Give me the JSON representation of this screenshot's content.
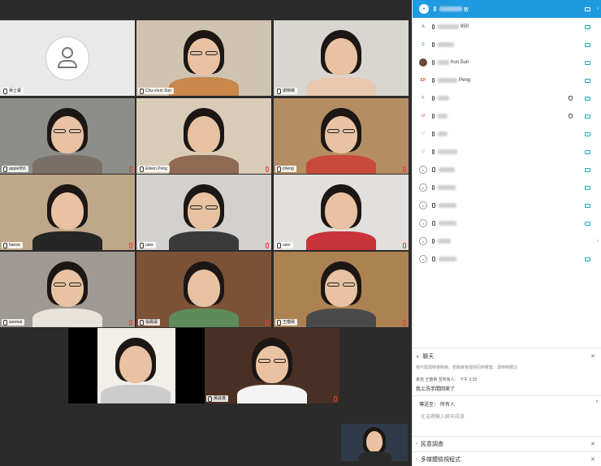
{
  "participants_panel": {
    "rows": [
      {
        "avatar": "icon",
        "avatar_color": "#1e9ae0",
        "name": "敷",
        "device": "mic",
        "camera": "on",
        "selected": true,
        "hand": false,
        "chevron": true
      },
      {
        "avatar": "A",
        "avatar_color": "#5aa6d8",
        "name": "950",
        "device": "mic",
        "camera": "on",
        "hand": false
      },
      {
        "avatar": "C",
        "avatar_color": "#3bb07a",
        "name": "",
        "device": "mic",
        "camera": "on",
        "hand": false
      },
      {
        "avatar": "photo",
        "avatar_color": "#6b4a3a",
        "name": "hun Sun",
        "device": "mic",
        "camera": "on",
        "hand": false
      },
      {
        "avatar": "EP",
        "avatar_color": "#e8594a",
        "name": "Peng",
        "device": "mic",
        "camera": "on",
        "hand": false
      },
      {
        "avatar": "F",
        "avatar_color": "#5aa6d8",
        "name": "",
        "device": "mic",
        "camera": "on",
        "hand": true
      },
      {
        "avatar": "U",
        "avatar_color": "#e8594a",
        "name": "",
        "device": "mic",
        "camera": "on",
        "hand": true
      },
      {
        "avatar": "U",
        "avatar_color": "#c7c7c7",
        "name": "",
        "device": "mic",
        "camera": "on",
        "hand": false
      },
      {
        "avatar": "U",
        "avatar_color": "#c7c7c7",
        "name": "",
        "device": "mic",
        "camera": "on",
        "hand": false
      },
      {
        "avatar": "person",
        "avatar_color": "#c7c7c7",
        "name": "",
        "device": "phone",
        "camera": "on",
        "hand": false
      },
      {
        "avatar": "person",
        "avatar_color": "#c7c7c7",
        "name": "",
        "device": "mic",
        "camera": "on",
        "hand": false
      },
      {
        "avatar": "person",
        "avatar_color": "#c7c7c7",
        "name": "",
        "device": "phone",
        "camera": "on",
        "hand": false
      },
      {
        "avatar": "person",
        "avatar_color": "#c7c7c7",
        "name": "",
        "device": "phone",
        "camera": "on",
        "hand": false
      },
      {
        "avatar": "person",
        "avatar_color": "#c7c7c7",
        "name": "",
        "device": "mic",
        "camera": "none",
        "hand": false
      },
      {
        "avatar": "person",
        "avatar_color": "#c7c7c7",
        "name": "",
        "device": "phone",
        "camera": "on",
        "hand": false
      }
    ]
  },
  "chat": {
    "header": "聊天",
    "line1": "我可能隨時會斷線，若斷線會儘快回到教室，請時時關注",
    "from_line": "來自 王瓊眞 至所有人：  下午 3:32",
    "message": "我上洗手間回來了",
    "to_label": "傳送至：",
    "to_value": "所有人",
    "input_placeholder": "在這裡輸入聊天訊息"
  },
  "sections": {
    "poll": "民意調查",
    "multimedia": "多媒體檢視程式"
  },
  "video_tiles": [
    {
      "name": "黃士寶",
      "kind": "avatar",
      "bg": "#e9e9e9",
      "red_mic": false
    },
    {
      "name": "Chu-chun Sun",
      "kind": "person",
      "bg": "#cfc3b2",
      "shirt": "#c9874a",
      "red_mic": false
    },
    {
      "name": "謝曉薇",
      "kind": "person",
      "bg": "#d9d6d2",
      "shirt": "#e9c8b0",
      "red_mic": false
    },
    {
      "name": "apple950",
      "kind": "person",
      "bg": "#8d8d8a",
      "shirt": "#7a6f66",
      "red_mic": true
    },
    {
      "name": "Eileen Peng",
      "kind": "person",
      "bg": "#d8ccb8",
      "shirt": "#8f6b52",
      "red_mic": true
    },
    {
      "name": "cheng",
      "kind": "person",
      "bg": "#b58d63",
      "shirt": "#c84a3a",
      "red_mic": true
    },
    {
      "name": "hanse",
      "kind": "person",
      "bg": "#bfa88a",
      "shirt": "#262626",
      "red_mic": true
    },
    {
      "name": "user",
      "kind": "person",
      "bg": "#d3d1cd",
      "shirt": "#3a3a3a",
      "red_mic": true
    },
    {
      "name": "user",
      "kind": "person",
      "bg": "#e2e0dd",
      "shirt": "#c8343a",
      "red_mic": true
    },
    {
      "name": "seemai",
      "kind": "person",
      "bg": "#9f9a93",
      "shirt": "#e8e4dc",
      "red_mic": true
    },
    {
      "name": "張鳳蓮",
      "kind": "person",
      "bg": "#7c5236",
      "shirt": "#5f8a5a",
      "red_mic": true
    },
    {
      "name": "王瓊眞",
      "kind": "person",
      "bg": "#ad8253",
      "shirt": "#4a4a4a",
      "red_mic": true
    },
    {
      "name": "蔡惠慈",
      "kind": "person",
      "bg": "#f2efe9",
      "shirt": "#ccc",
      "red_mic": true
    },
    {
      "name": "黃詠真",
      "kind": "person",
      "bg": "#4a3024",
      "shirt": "#f4f4f4",
      "red_mic": true
    }
  ],
  "self_view": {
    "kind": "person",
    "bg": "#2f3b4a"
  }
}
